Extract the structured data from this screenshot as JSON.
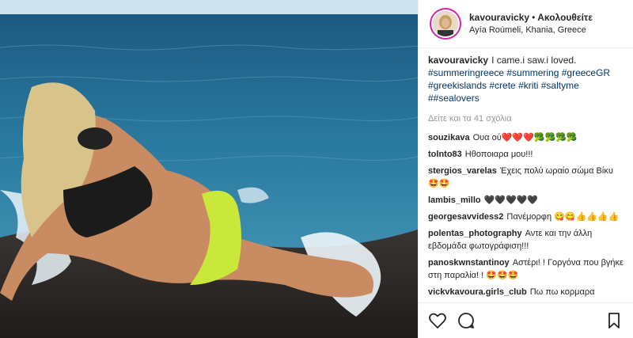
{
  "post": {
    "username": "kavouravicky",
    "follow_label": "Ακολουθείτε",
    "location": "Ayía Roúmeli, Khania, Greece",
    "caption": {
      "text": "I came.i saw.i loved.",
      "hashtags": "#summeringreece #summering #greeceGR #greekislands #crete #kriti #saltyme ##sealovers"
    },
    "view_more_label": "Δείτε και τα 41 σχόλια"
  },
  "comments": [
    {
      "user": "souzikava",
      "text": "Ουα ού❤️❤️❤️🥦🥦🥦🥦"
    },
    {
      "user": "tolnto83",
      "text": "Ηθοποιαρα μου!!!"
    },
    {
      "user": "stergios_varelas",
      "text": "Έχεις πολύ ωραίο σώμα Βίκυ 🤩🤩"
    },
    {
      "user": "lambis_millo",
      "text": "🖤🖤🖤🖤🖤"
    },
    {
      "user": "georgesavvidess2",
      "text": "Πανέμορφη 😋😋👍👍👍👍"
    },
    {
      "user": "polentas_photography",
      "text": "Αντε και την άλλη εβδομάδα φωτογράφιση!!!"
    },
    {
      "user": "panoskwnstantinoy",
      "text": "Αστέρι! ! Γοργόνα που βγήκε στη παραλία! ! 🤩🤩🤩"
    },
    {
      "user": "vickvkavoura.girls_club",
      "text": "Πω πω κορμαρα"
    }
  ]
}
